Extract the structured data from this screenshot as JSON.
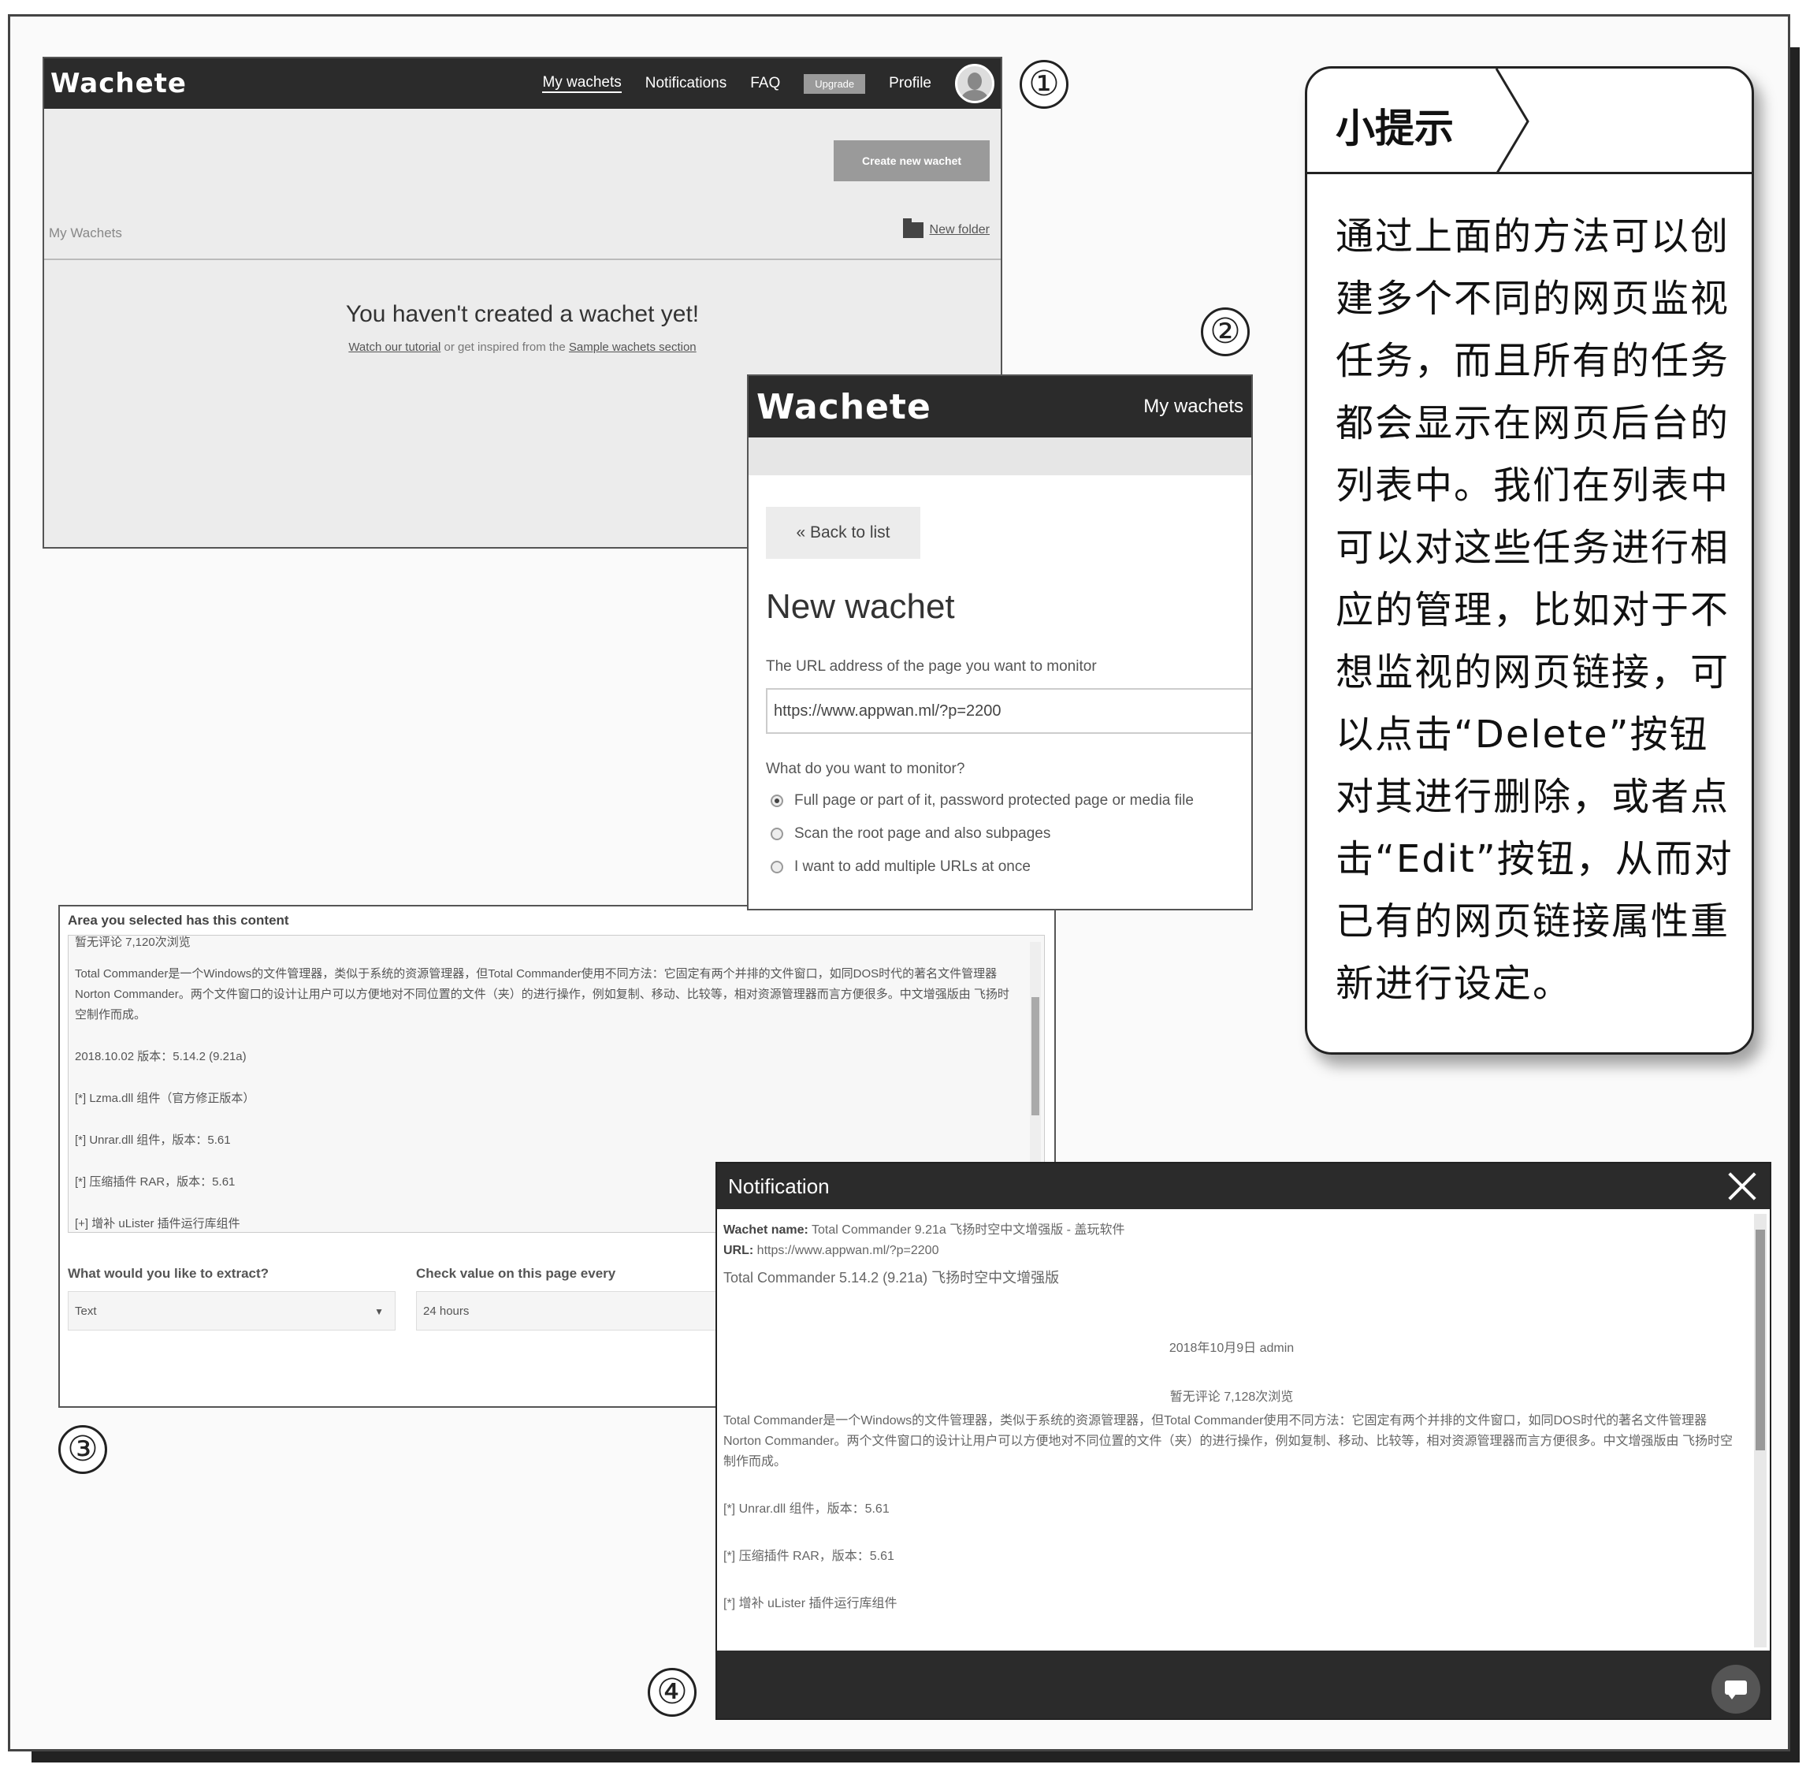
{
  "markers": [
    "①",
    "②",
    "③",
    "④"
  ],
  "panel1": {
    "logo": "Wachete",
    "nav": [
      "My wachets",
      "Notifications",
      "FAQ"
    ],
    "upgrade": "Upgrade",
    "profile": "Profile",
    "create_button": "Create new wachet",
    "list_title": "My Wachets",
    "new_folder": "New folder",
    "empty_title": "You haven't created a wachet yet!",
    "empty_link1": "Watch our tutorial",
    "empty_mid": " or get inspired from the ",
    "empty_link2": "Sample wachets section"
  },
  "panel2": {
    "logo": "Wachete",
    "nav": "My wachets",
    "back": "« Back to list",
    "title": "New wachet",
    "url_label": "The URL address of the page you want to monitor",
    "url_value": "https://www.appwan.ml/?p=2200",
    "monitor_label": "What do you want to monitor?",
    "options": [
      "Full page or part of it, password protected page or media file",
      "Scan the root page and also subpages",
      "I want to add multiple URLs at once"
    ]
  },
  "panel3": {
    "header": "Area you selected has this content",
    "lines": [
      "暂无评论    7,120次浏览",
      "Total Commander是一个Windows的文件管理器，类似于系统的资源管理器，但Total Commander使用不同方法：它固定有两个并排的文件窗口，如同DOS时代的著名文件管理器Norton Commander。两个文件窗口的设计让用户可以方便地对不同位置的文件（夹）的进行操作，例如复制、移动、比较等，相对资源管理器而言方便很多。中文增强版由 飞扬时空制作而成。",
      "2018.10.02  版本：5.14.2 (9.21a)",
      "[*] Lzma.dll 组件（官方修正版本）",
      "[*] Unrar.dll 组件，版本：5.61",
      "[*] 压缩插件 RAR，版本：5.61",
      "[+] 增补 uLister 插件运行库组件"
    ],
    "extract_label": "What would you like to extract?",
    "extract_value": "Text",
    "check_label": "Check value on this page every",
    "check_value": "24 hours"
  },
  "panel4": {
    "title": "Notification",
    "name_label": "Wachet name:",
    "name_value": " Total Commander 9.21a 飞扬时空中文增强版 - 盖玩软件",
    "url_label": "URL:",
    "url_value": " https://www.appwan.ml/?p=2200",
    "heading": "Total Commander 5.14.2 (9.21a) 飞扬时空中文增强版",
    "date": "2018年10月9日    admin",
    "views": "暂无评论    7,128次浏览",
    "desc": "Total Commander是一个Windows的文件管理器，类似于系统的资源管理器，但Total Commander使用不同方法：它固定有两个并排的文件窗口，如同DOS时代的著名文件管理器Norton Commander。两个文件窗口的设计让用户可以方便地对不同位置的文件（夹）的进行操作，例如复制、移动、比较等，相对资源管理器而言方便很多。中文增强版由 飞扬时空制作而成。",
    "items": [
      "[*] Unrar.dll 组件，版本：5.61",
      "[*] 压缩插件 RAR，版本：5.61",
      "[*] 增补 uLister 插件运行库组件"
    ]
  },
  "tip": {
    "title": "小提示",
    "body": "通过上面的方法可以创建多个不同的网页监视任务，而且所有的任务都会显示在网页后台的列表中。我们在列表中可以对这些任务进行相应的管理，比如对于不想监视的网页链接，可以点击“Delete”按钮对其进行删除，或者点击“Edit”按钮，从而对已有的网页链接属性重新进行设定。"
  }
}
